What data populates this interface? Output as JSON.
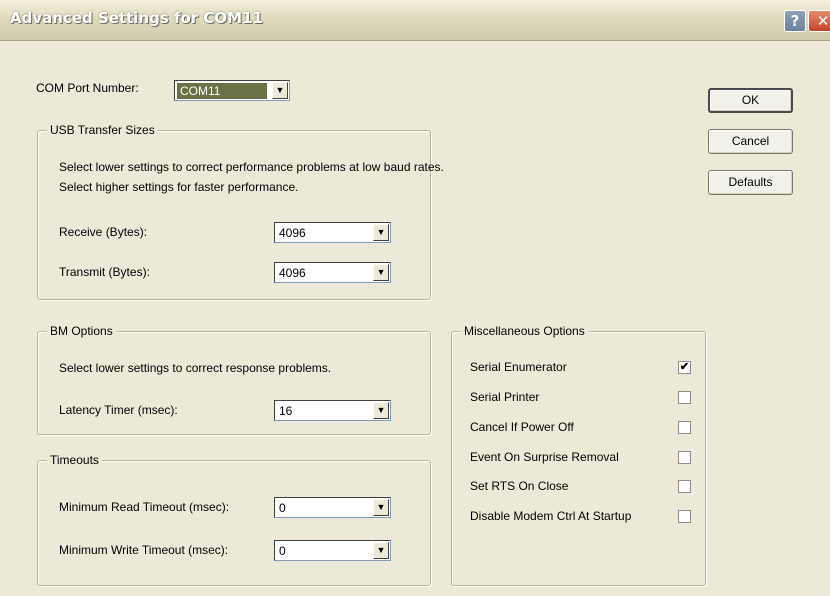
{
  "window": {
    "title": "Advanced Settings for COM11",
    "help_label": "?",
    "close_label": "✕"
  },
  "com_port": {
    "label": "COM Port Number:",
    "value": "COM11"
  },
  "usb_transfer": {
    "title": "USB Transfer Sizes",
    "line1": "Select lower settings to correct performance problems at low baud rates.",
    "line2": "Select higher settings for faster performance.",
    "receive_label": "Receive (Bytes):",
    "receive_value": "4096",
    "transmit_label": "Transmit (Bytes):",
    "transmit_value": "4096"
  },
  "bm_options": {
    "title": "BM Options",
    "description": "Select lower settings to correct response problems.",
    "latency_label": "Latency Timer (msec):",
    "latency_value": "16"
  },
  "timeouts": {
    "title": "Timeouts",
    "read_label": "Minimum Read Timeout (msec):",
    "read_value": "0",
    "write_label": "Minimum Write Timeout (msec):",
    "write_value": "0"
  },
  "misc": {
    "title": "Miscellaneous Options",
    "items": [
      {
        "label": "Serial Enumerator",
        "checked": true
      },
      {
        "label": "Serial Printer",
        "checked": false
      },
      {
        "label": "Cancel If Power Off",
        "checked": false
      },
      {
        "label": "Event On Surprise Removal",
        "checked": false
      },
      {
        "label": "Set RTS On Close",
        "checked": false
      },
      {
        "label": "Disable Modem Ctrl At Startup",
        "checked": false
      }
    ]
  },
  "buttons": {
    "ok": "OK",
    "cancel": "Cancel",
    "defaults": "Defaults"
  },
  "dropdown_arrow": "▼",
  "checkmark": "✔",
  "colors": {
    "dialog_bg": "#ece9d8",
    "selection": "#6b7045",
    "titlebar": "#e2ddc2"
  }
}
